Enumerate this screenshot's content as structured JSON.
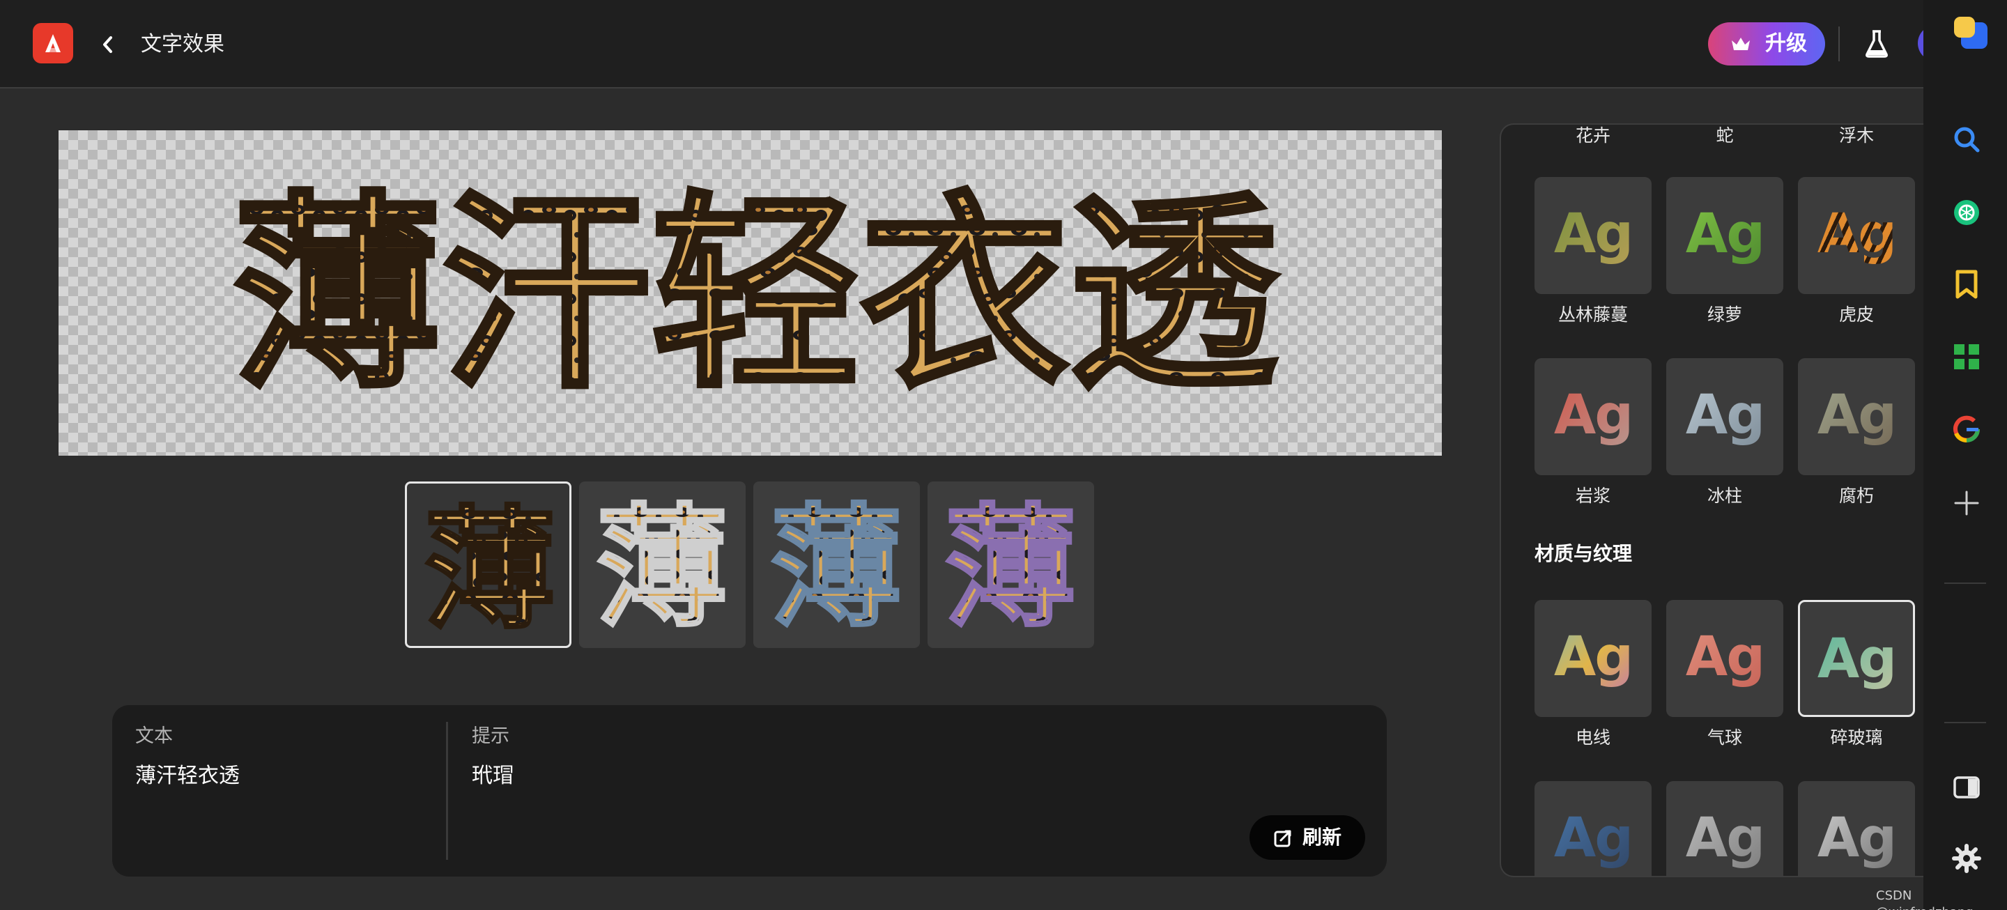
{
  "header": {
    "app_logo_icon": "adobe-express-logo",
    "back_icon": "chevron-left-icon",
    "title": "文字效果",
    "upgrade_label": "升级",
    "upgrade_icon": "crown-icon",
    "labs_icon": "flask-icon"
  },
  "rail": {
    "icons": [
      "avatar-icon",
      "search-icon",
      "chatgpt-icon",
      "bookmark-icon",
      "grid-apps-icon",
      "google-icon",
      "plus-icon",
      "sidebar-toggle-icon",
      "settings-icon"
    ]
  },
  "canvas": {
    "text": "薄汗轻衣透"
  },
  "variations": {
    "glyph": "薄",
    "selected_index": 0,
    "count": 4
  },
  "prompt": {
    "text_label": "文本",
    "text_value": "薄汗轻衣透",
    "hint_label": "提示",
    "hint_value": "玳瑁",
    "refresh_label": "刷新"
  },
  "effects": {
    "tile_glyph": "Ag",
    "top_row_labels": [
      "花卉",
      "蛇",
      "浮木"
    ],
    "row1": [
      {
        "label": "丛林藤蔓",
        "colors": [
          "#6b8f3a",
          "#c6a15b"
        ]
      },
      {
        "label": "绿萝",
        "colors": [
          "#8fd14a",
          "#3f7a2a"
        ]
      },
      {
        "label": "虎皮",
        "colors": [
          "#e08a2e",
          "#2b1a0d"
        ]
      }
    ],
    "row2": [
      {
        "label": "岩浆",
        "colors": [
          "#d8473a",
          "#b0a9a3"
        ]
      },
      {
        "label": "冰柱",
        "colors": [
          "#c9d7e0",
          "#6d7c88"
        ]
      },
      {
        "label": "腐朽",
        "colors": [
          "#a9b39a",
          "#6b5a48"
        ]
      }
    ],
    "section_title": "材质与纹理",
    "row3": [
      {
        "label": "电线",
        "colors": [
          "#5fb8d6",
          "#e0b54a"
        ]
      },
      {
        "label": "气球",
        "colors": [
          "#e79a86",
          "#c0584e"
        ]
      },
      {
        "label": "碎玻璃",
        "colors": [
          "#3fb59a",
          "#d9c6a3"
        ],
        "selected": true
      }
    ],
    "row4": [
      {
        "label": "",
        "colors": [
          "#4d7fb6",
          "#2b3a55"
        ]
      },
      {
        "label": "",
        "colors": [
          "#cfcfcf",
          "#6a6a6a"
        ]
      },
      {
        "label": "",
        "colors": [
          "#e5e5e5",
          "#5a5a5a"
        ]
      }
    ]
  },
  "watermark": "CSDN @winfredzhang"
}
